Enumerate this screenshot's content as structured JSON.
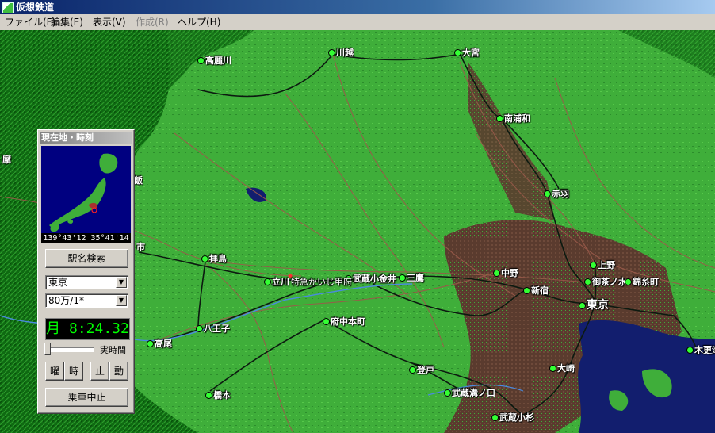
{
  "window": {
    "title": "仮想鉄道"
  },
  "menu": [
    {
      "label": "ファイル(F)",
      "enabled": true
    },
    {
      "label": "編集(E)",
      "enabled": true
    },
    {
      "label": "表示(V)",
      "enabled": true
    },
    {
      "label": "作成(R)",
      "enabled": false
    },
    {
      "label": "ヘルプ(H)",
      "enabled": true
    }
  ],
  "map": {
    "colors": {
      "forest": "#0f6a12",
      "plain": "#3fae3a",
      "urban": "#5a3b2e",
      "sea": "#121e6e",
      "rail": "#9a5a4a"
    },
    "stations": [
      {
        "name": "高麗川",
        "big": false
      },
      {
        "name": "川越",
        "big": false
      },
      {
        "name": "大宮",
        "big": false
      },
      {
        "name": "南浦和",
        "big": false
      },
      {
        "name": "赤羽",
        "big": false
      },
      {
        "name": "上野",
        "big": false
      },
      {
        "name": "御茶ノ水",
        "big": false
      },
      {
        "name": "錦糸町",
        "big": false
      },
      {
        "name": "東京",
        "big": true
      },
      {
        "name": "中野",
        "big": false
      },
      {
        "name": "新宿",
        "big": false
      },
      {
        "name": "三鷹",
        "big": false
      },
      {
        "name": "武蔵小金井",
        "big": false
      },
      {
        "name": "立川",
        "big": false
      },
      {
        "name": "拝島",
        "big": false
      },
      {
        "name": "八王子",
        "big": false
      },
      {
        "name": "高尾",
        "big": false
      },
      {
        "name": "府中本町",
        "big": false
      },
      {
        "name": "登戸",
        "big": false
      },
      {
        "name": "武蔵溝ノ口",
        "big": false
      },
      {
        "name": "武蔵小杉",
        "big": false
      },
      {
        "name": "大崎",
        "big": false
      },
      {
        "name": "橋本",
        "big": false
      },
      {
        "name": "木更津",
        "big": false
      },
      {
        "name": "市",
        "big": false
      },
      {
        "name": "飯",
        "big": false
      },
      {
        "name": "摩",
        "big": false
      }
    ],
    "train_label": "特急かいじ甲府"
  },
  "panel": {
    "title": "現在地・時刻",
    "coords": "139°43'12 35°41'14",
    "search_button": "駅名検索",
    "station_select": "東京",
    "scale_select": "80万/1*",
    "clock": "月 8:24.32",
    "realtime_label": "実時間",
    "buttons": [
      "曜",
      "時",
      "止",
      "動"
    ],
    "stop_ride_button": "乗車中止"
  }
}
